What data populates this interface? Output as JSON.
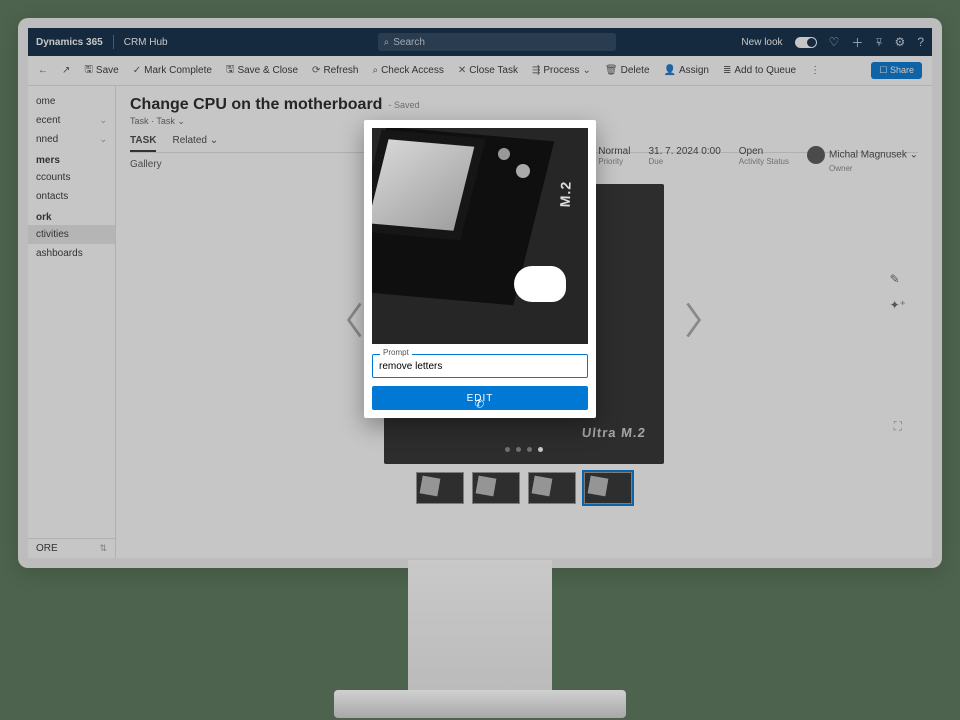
{
  "topbar": {
    "brand": "Dynamics 365",
    "hub": "CRM Hub",
    "search_placeholder": "Search",
    "newlook": "New look"
  },
  "cmdbar": {
    "save": "Save",
    "mark_complete": "Mark Complete",
    "save_close": "Save & Close",
    "refresh": "Refresh",
    "check_access": "Check Access",
    "close_task": "Close Task",
    "process": "Process",
    "delete": "Delete",
    "assign": "Assign",
    "add_queue": "Add to Queue",
    "share": "Share"
  },
  "sidebar": {
    "home": "ome",
    "recent": "ecent",
    "pinned": "nned",
    "customers_head": "mers",
    "accounts": "ccounts",
    "contacts": "ontacts",
    "work_head": "ork",
    "activities": "ctivities",
    "dashboards": "ashboards",
    "footer": "ORE"
  },
  "page": {
    "title": "Change CPU on the motherboard",
    "saved": "- Saved",
    "crumb1": "Task",
    "crumb2": "Task",
    "tab_task": "TASK",
    "tab_related": "Related",
    "section_gallery": "Gallery"
  },
  "metrics": {
    "priority_v": "Normal",
    "priority_l": "Priority",
    "due_v": "31. 7. 2024 0:00",
    "due_l": "Due",
    "status_v": "Open",
    "status_l": "Activity Status",
    "owner_v": "Michal Magnusek",
    "owner_l": "Owner"
  },
  "gallery": {
    "m2_label": "Ultra M.2",
    "m2_short": "M.2"
  },
  "modal": {
    "prompt_label": "Prompt",
    "prompt_value": "remove letters",
    "edit": "EDIT"
  }
}
